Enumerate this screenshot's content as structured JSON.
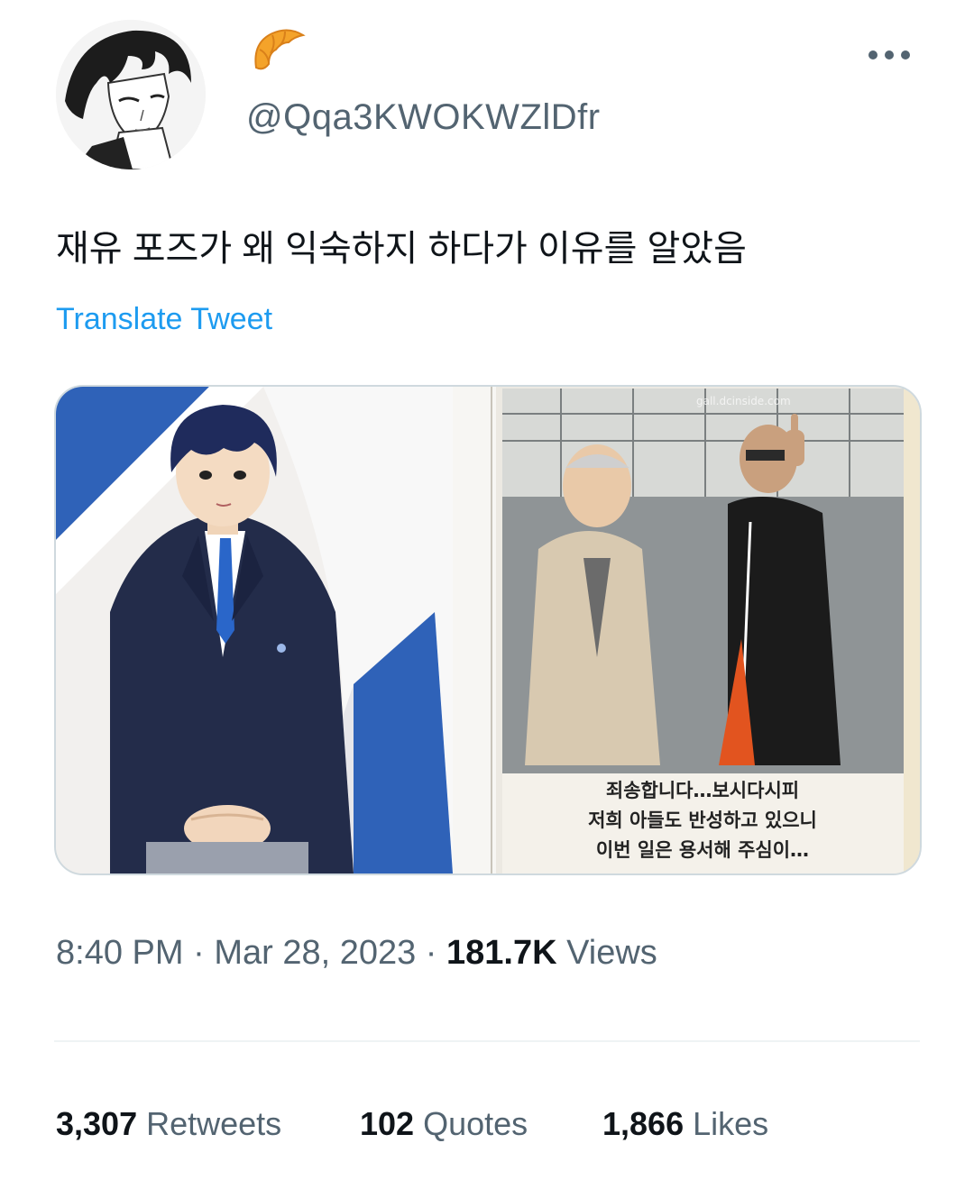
{
  "user": {
    "handle": "@Qqa3KWOKWZlDfr",
    "avatar_icon": "anime-avatar",
    "badge_icon": "croissant-icon"
  },
  "tweet": {
    "text": "재유 포즈가 왜 익숙하지 하다가 이유를 알았음",
    "translate_label": "Translate Tweet",
    "media": {
      "watermark": "gall.dcinside.com",
      "caption_lines": [
        "죄송합니다…보시다시피",
        "저희 아들도 반성하고 있으니",
        "이번 일은 용서해 주심이…"
      ]
    }
  },
  "meta": {
    "time": "8:40 PM",
    "separator": "·",
    "date": "Mar 28, 2023",
    "views_count": "181.7K",
    "views_label": "Views"
  },
  "stats": {
    "retweets_count": "3,307",
    "retweets_label": "Retweets",
    "quotes_count": "102",
    "quotes_label": "Quotes",
    "likes_count": "1,866",
    "likes_label": "Likes"
  },
  "colors": {
    "link": "#1d9bf0",
    "secondary_text": "#536471",
    "primary_text": "#0f1419",
    "border": "#cfd9de"
  }
}
